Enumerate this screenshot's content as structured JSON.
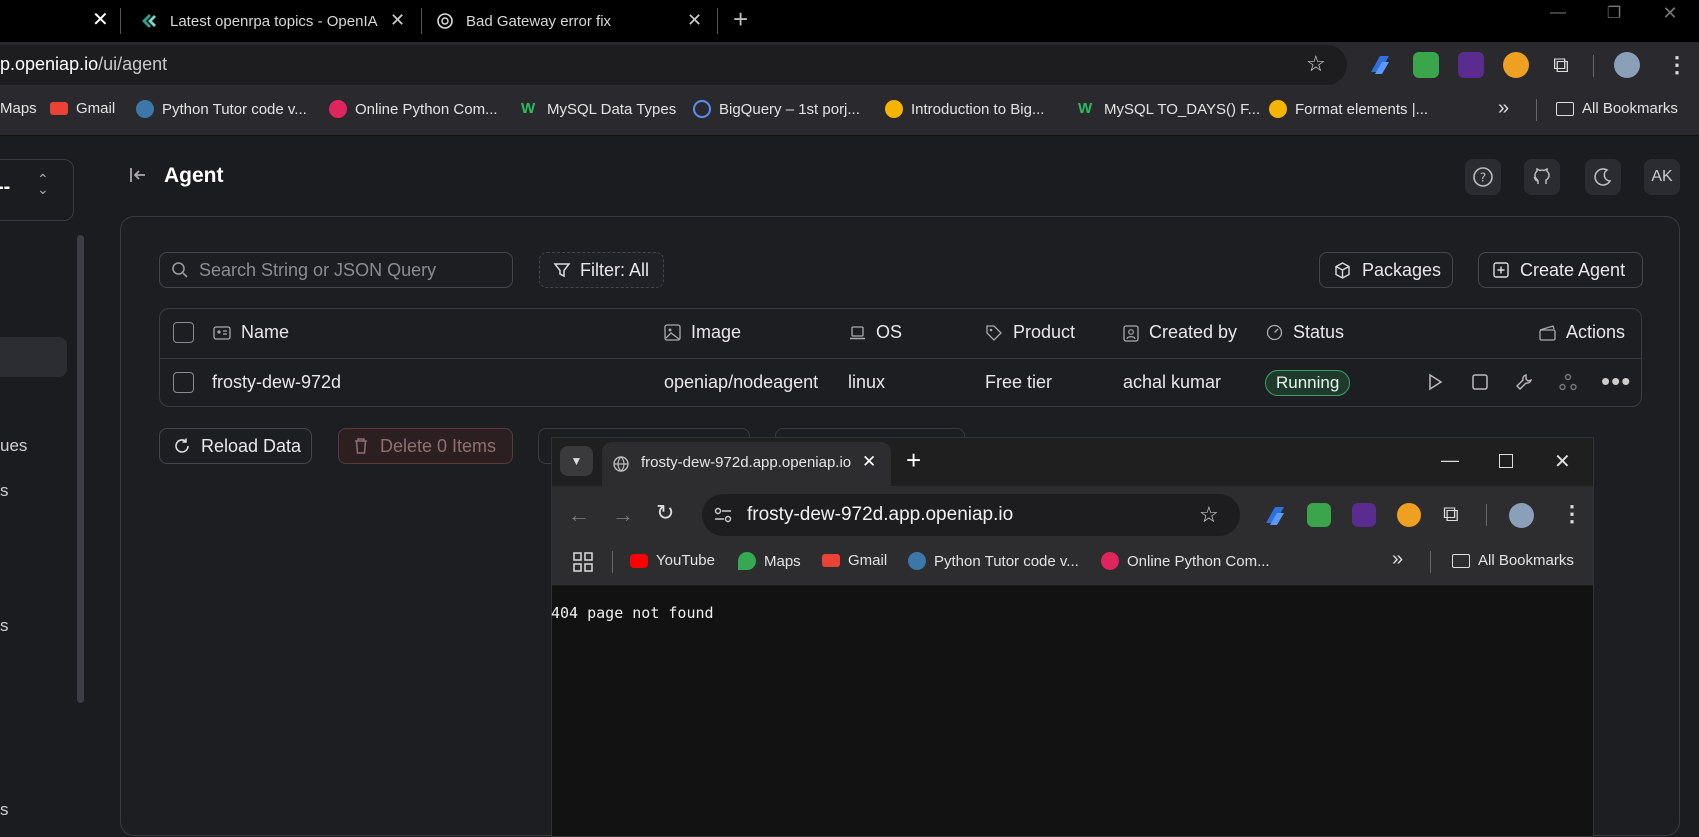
{
  "browser": {
    "tabs": [
      {
        "title": "Latest openrpa topics - OpenIA"
      },
      {
        "title": "Bad Gateway error fix"
      }
    ],
    "url_host": "p.openiap.io",
    "url_path": "/ui/agent",
    "bookmarks": [
      "Maps",
      "Gmail",
      "Python Tutor code v...",
      "Online Python Com...",
      "MySQL Data Types",
      "BigQuery – 1st porj...",
      "Introduction to Big...",
      "MySQL TO_DAYS() F...",
      "Format elements  |..."
    ],
    "all_bookmarks": "All Bookmarks"
  },
  "sidebar": {
    "select_text": "--",
    "fragments": [
      "ues",
      "s",
      "s",
      "s"
    ]
  },
  "header": {
    "title": "Agent",
    "avatar": "AK"
  },
  "toolbar": {
    "search_placeholder": "Search String or JSON Query",
    "filter_label": "Filter: All",
    "packages_label": "Packages",
    "create_label": "Create Agent"
  },
  "table": {
    "columns": [
      "Name",
      "Image",
      "OS",
      "Product",
      "Created by",
      "Status",
      "Actions"
    ],
    "rows": [
      {
        "name": "frosty-dew-972d",
        "image": "openiap/nodeagent",
        "os": "linux",
        "product": "Free tier",
        "created_by": "achal kumar",
        "status": "Running"
      }
    ]
  },
  "actions": {
    "reload": "Reload Data",
    "delete": "Delete 0 Items"
  },
  "popup": {
    "tab_title": "frosty-dew-972d.app.openiap.io",
    "url": "frosty-dew-972d.app.openiap.io",
    "bookmarks": [
      "YouTube",
      "Maps",
      "Gmail",
      "Python Tutor code v...",
      "Online Python Com..."
    ],
    "all_bookmarks": "All Bookmarks",
    "body_text": "404 page not found"
  },
  "colors": {
    "status_running_bg": "#1f3a2c",
    "status_running_border": "#3f9f6b",
    "accent_blue": "#4a7cf0"
  }
}
